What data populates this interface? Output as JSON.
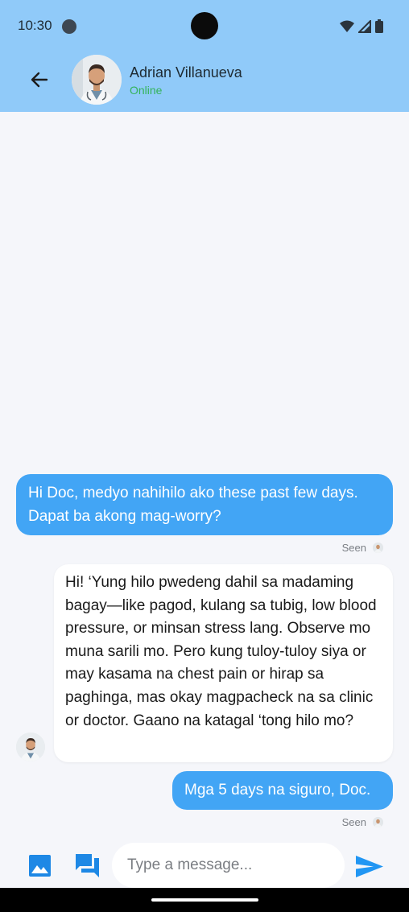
{
  "status_bar": {
    "time": "10:30"
  },
  "header": {
    "contact_name": "Adrian Villanueva",
    "presence": "Online",
    "presence_color": "#34b35a",
    "background": "#90caf9"
  },
  "messages": [
    {
      "sender": "me",
      "text": "Hi Doc, medyo nahihilo ako these past few days. Dapat ba akong mag-worry?",
      "status": "Seen"
    },
    {
      "sender": "doctor",
      "text": "Hi! ‘Yung hilo pwedeng dahil sa madaming bagay—like pagod, kulang sa tubig, low blood pressure, or minsan stress lang. Observe mo muna sarili mo. Pero kung tuloy-tuloy siya or may kasama na chest pain or hirap sa paghinga, mas okay magpacheck na sa clinic or doctor. Gaano na katagal ‘tong hilo mo?"
    },
    {
      "sender": "me",
      "text": "Mga 5 days na siguro, Doc.",
      "status": "Seen"
    }
  ],
  "composer": {
    "placeholder": "Type a message...",
    "icons": [
      "image-icon",
      "chat-icon",
      "send-icon"
    ]
  },
  "colors": {
    "outgoing_bubble": "#42a5f5",
    "incoming_bubble": "#ffffff",
    "send_icon": "#2196f3",
    "composer_icons": "#1e88e5"
  }
}
